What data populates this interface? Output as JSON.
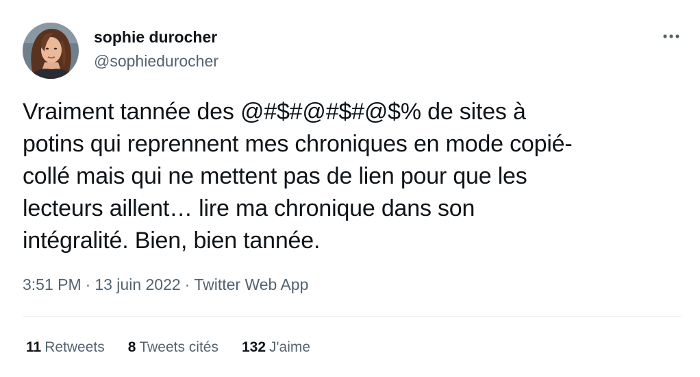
{
  "user": {
    "display_name": "sophie durocher",
    "handle": "@sophiedurocher"
  },
  "tweet": {
    "text_lines": [
      "Vraiment tannée des @#$#@#$#@$% de sites à",
      "potins qui reprennent mes chroniques en mode copié-",
      "collé mais qui ne mettent pas de lien pour que les",
      "lecteurs aillent… lire ma chronique dans son",
      "intégralité. Bien, bien tannée."
    ],
    "time": "3:51 PM",
    "date": "13 juin 2022",
    "source": "Twitter Web App",
    "separator": "·"
  },
  "stats": {
    "retweets": {
      "count": "11",
      "label": "Retweets"
    },
    "quotes": {
      "count": "8",
      "label": "Tweets cités"
    },
    "likes": {
      "count": "132",
      "label": "J'aime"
    }
  },
  "icons": {
    "more": "more-dots-icon"
  },
  "colors": {
    "text_primary": "#0f1419",
    "text_secondary": "#536471",
    "divider": "#eff3f4"
  }
}
